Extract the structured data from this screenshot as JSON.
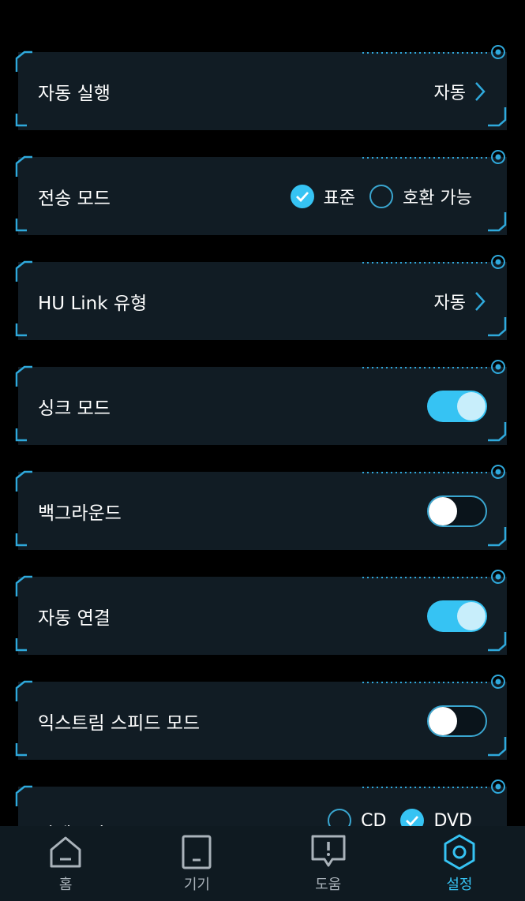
{
  "settings": {
    "auto_run": {
      "label": "자동 실행",
      "value": "자동"
    },
    "transfer_mode": {
      "label": "전송 모드",
      "options": [
        {
          "label": "표준",
          "selected": true
        },
        {
          "label": "호환 가능",
          "selected": false
        }
      ]
    },
    "hu_link_type": {
      "label": "HU Link 유형",
      "value": "자동"
    },
    "sync_mode": {
      "label": "싱크 모드",
      "on": true
    },
    "background": {
      "label": "백그라운드",
      "on": false
    },
    "auto_connect": {
      "label": "자동 연결",
      "on": true
    },
    "extreme_speed_mode": {
      "label": "익스트림 스피드 모드",
      "on": false
    },
    "category": {
      "label": "카테고리",
      "options": [
        {
          "label": "CD",
          "selected": false
        },
        {
          "label": "DVD",
          "selected": true
        }
      ]
    }
  },
  "tabs": [
    {
      "label": "홈",
      "icon": "home-icon",
      "active": false
    },
    {
      "label": "기기",
      "icon": "device-icon",
      "active": false
    },
    {
      "label": "도움",
      "icon": "help-icon",
      "active": false
    },
    {
      "label": "설정",
      "icon": "settings-icon",
      "active": true
    }
  ],
  "colors": {
    "accent": "#36c3f3",
    "card": "#111c24",
    "frame": "#2fa9dc",
    "tabbar": "#0f1a21",
    "inactive_tab": "#aab3ba"
  }
}
